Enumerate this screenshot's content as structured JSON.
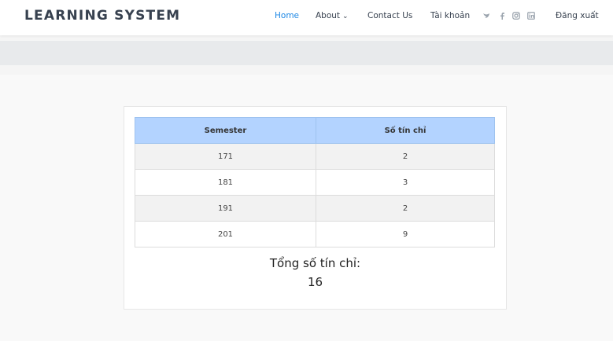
{
  "header": {
    "logo": "LEARNING SYSTEM",
    "nav": {
      "home": "Home",
      "about": "About",
      "contact": "Contact Us",
      "account": "Tài khoản",
      "logout": "Đăng xuất"
    },
    "social_icons": [
      "twitter-icon",
      "facebook-icon",
      "instagram-icon",
      "linkedin-icon"
    ],
    "accent_color": "#1e88e5"
  },
  "table": {
    "headers": [
      "Semester",
      "Số tín chỉ"
    ],
    "rows": [
      [
        "171",
        "2"
      ],
      [
        "181",
        "3"
      ],
      [
        "191",
        "2"
      ],
      [
        "201",
        "9"
      ]
    ],
    "header_color": "#b3d3ff"
  },
  "summary": {
    "label": "Tổng số tín chỉ:",
    "value": "16"
  }
}
